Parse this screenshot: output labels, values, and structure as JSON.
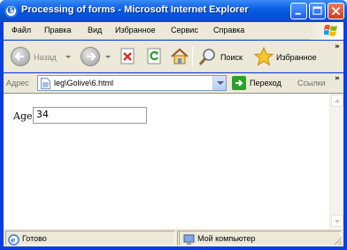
{
  "window": {
    "title": "Processing of forms - Microsoft Internet Explorer"
  },
  "menu": {
    "items": [
      "Файл",
      "Правка",
      "Вид",
      "Избранное",
      "Сервис",
      "Справка"
    ]
  },
  "toolbar": {
    "back_label": "Назад",
    "search_label": "Поиск",
    "favorites_label": "Избранное"
  },
  "address": {
    "label": "Адрес",
    "value": "leg\\Golive\\6.html",
    "go_label": "Переход",
    "links_label": "Ссылки"
  },
  "form": {
    "label": "Age",
    "input_value": "34"
  },
  "status": {
    "text": "Готово",
    "zone": "Мой компьютер"
  },
  "colors": {
    "titlebar": "#0a5fe6",
    "chrome": "#ece9d8",
    "go_button": "#2aa12a"
  }
}
